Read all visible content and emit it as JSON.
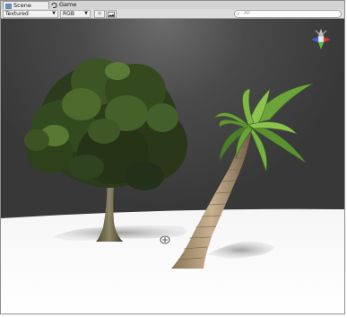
{
  "tabs": [
    {
      "label": "Scene",
      "icon": "scene-icon"
    },
    {
      "label": "Game",
      "icon": "game-icon"
    }
  ],
  "toolbar": {
    "render_mode": "Textured",
    "color_mode": "RGB",
    "buttons": [
      "lighting-toggle-icon",
      "image-effects-icon"
    ],
    "search_placeholder": "All"
  },
  "scene": {
    "gizmo": "orientation-gizmo",
    "objects": [
      "deciduous-tree",
      "palm-tree"
    ]
  }
}
